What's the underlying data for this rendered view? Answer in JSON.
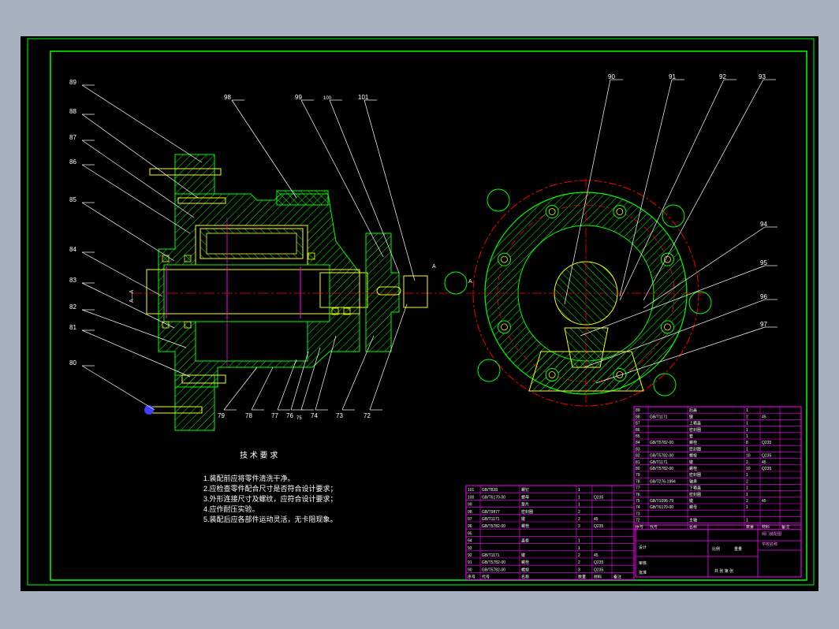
{
  "colors": {
    "background": "#000000",
    "frame": "#00ff00",
    "hatch": "#00ff00",
    "part_outline": "#ffff00",
    "centerline": "#ff0000",
    "dimension": "#ff00ff",
    "leader": "#ffffff",
    "bolt": "#4040ff"
  },
  "left_view": {
    "labels_left": [
      "89",
      "88",
      "87",
      "86",
      "85",
      "84",
      "83",
      "82",
      "81",
      "80"
    ],
    "labels_top": [
      "98",
      "99",
      "100",
      "101"
    ],
    "labels_bottom": [
      "79",
      "78",
      "77",
      "76",
      "75",
      "74",
      "73",
      "72"
    ],
    "section_mark": "A—A",
    "section_letter": "A"
  },
  "right_view": {
    "labels_top": [
      "90",
      "91",
      "92",
      "93"
    ],
    "labels_right": [
      "94",
      "95",
      "96",
      "97"
    ],
    "section_letter": "A"
  },
  "requirements": {
    "title": "技 术 要 求",
    "items": [
      "1.装配前应将零件清洗干净。",
      "2.应检查零件配合尺寸是否符合设计要求；",
      "3.外形连接尺寸及螺纹，应符合设计要求；",
      "4.应作耐压实验。",
      "5.装配后应各部件运动灵活，无卡阻现象。"
    ]
  },
  "bom_left": {
    "rows": [
      [
        "101",
        "GB/T828",
        "螺钉",
        "1",
        "",
        ""
      ],
      [
        "100",
        "GB/T6170-00",
        "螺母",
        "1",
        "Q235",
        ""
      ],
      [
        "99",
        "",
        "垫片",
        "1",
        "",
        ""
      ],
      [
        "98",
        "GB/T9877",
        "密封圈",
        "2",
        "",
        ""
      ],
      [
        "97",
        "GB/T1171",
        "键",
        "2",
        "45",
        ""
      ],
      [
        "96",
        "GB/T5782-00",
        "螺栓",
        "3",
        "Q235",
        ""
      ],
      [
        "95",
        "",
        "",
        "",
        "",
        ""
      ],
      [
        "94",
        "",
        "盖板",
        "1",
        "",
        ""
      ],
      [
        "93",
        "",
        "",
        "1",
        "",
        ""
      ],
      [
        "92",
        "GB/T1171",
        "键",
        "2",
        "45",
        ""
      ],
      [
        "91",
        "GB/T5782-00",
        "螺栓",
        "2",
        "Q235",
        ""
      ],
      [
        "90",
        "GB/T5782-00",
        "螺栓",
        "3",
        "Q235",
        ""
      ]
    ],
    "header": [
      "序号",
      "代号",
      "名称",
      "数量",
      "材料",
      "备注"
    ]
  },
  "bom_right": {
    "rows": [
      [
        "89",
        "",
        "后盖",
        "1",
        "",
        ""
      ],
      [
        "88",
        "GB/T1171",
        "键",
        "2",
        "45",
        ""
      ],
      [
        "87",
        "",
        "上箱盖",
        "1",
        "",
        ""
      ],
      [
        "86",
        "",
        "密封圈",
        "1",
        "",
        ""
      ],
      [
        "85",
        "",
        "套",
        "1",
        "",
        ""
      ],
      [
        "84",
        "GB/T5782-00",
        "螺栓",
        "8",
        "Q235",
        ""
      ],
      [
        "83",
        "",
        "密封圈",
        "1",
        "",
        ""
      ],
      [
        "82",
        "GB/T5782-00",
        "螺栓",
        "10",
        "Q235",
        ""
      ],
      [
        "81",
        "GB/T1171",
        "键",
        "2",
        "45",
        ""
      ],
      [
        "80",
        "GB/T5782-00",
        "螺栓",
        "10",
        "Q235",
        ""
      ],
      [
        "79",
        "",
        "密封圈",
        "1",
        "",
        ""
      ],
      [
        "78",
        "GB/T276-1994",
        "轴承",
        "2",
        "",
        ""
      ],
      [
        "77",
        "",
        "下箱盖",
        "1",
        "",
        ""
      ],
      [
        "76",
        "",
        "密封圈",
        "1",
        "",
        ""
      ],
      [
        "75",
        "GB/T1096-79",
        "键",
        "2",
        "45",
        ""
      ],
      [
        "74",
        "GB/T6170-00",
        "螺母",
        "1",
        "",
        ""
      ],
      [
        "73",
        "",
        "",
        "",
        "",
        ""
      ],
      [
        "72",
        "",
        "主轴",
        "1",
        "",
        ""
      ]
    ],
    "header": [
      "序号",
      "代号",
      "名称",
      "数量",
      "材料",
      "备注"
    ]
  },
  "title_block": {
    "drawing_name": "阀门装配图",
    "school": "学校名称",
    "scale_label": "比例",
    "sheet_label": "共 张 第 张",
    "weight_label": "重量",
    "designer": "设计",
    "checker": "审核",
    "approver": "批准"
  }
}
